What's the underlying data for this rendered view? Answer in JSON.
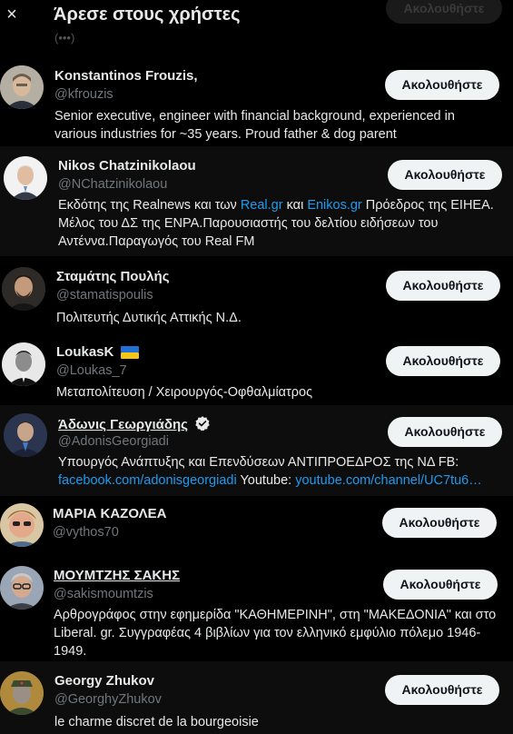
{
  "header": {
    "title": "Άρεσε στους χρήστες",
    "close_icon": "×",
    "partial_text": "(•••)"
  },
  "follow_label": "Ακολουθήστε",
  "users": [
    {
      "name": "Konstantinos Frouzis,",
      "handle": "@kfrouzis",
      "bio": "Senior executive, engineer with financial background, experienced in various industries for ~35 years. Proud father & dog parent"
    },
    {
      "name": "Nikos Chatzinikolaou",
      "handle": "@NChatzinikolaou",
      "bio_parts": [
        "Εκδότης της Realnews και των ",
        "Real.gr",
        " και ",
        "Enikos.gr",
        " Πρόεδρος της ΕΙΗΕΑ. Μέλος του ΔΣ της ΕΝΡΑ.Παρουσιαστής του δελτίου ειδήσεων του Αντέννα.Παραγωγός του Real FM"
      ]
    },
    {
      "name": "Σταμάτης Πουλής",
      "handle": "@stamatispoulis",
      "bio": "Πολιτευτής Δυτικής Αττικής Ν.Δ."
    },
    {
      "name": "LoukasK",
      "handle": "@Loukas_7",
      "flag": "ukraine-flag-emoji",
      "bio": "Μεταπολίτευση / Χειρουργός-Οφθαλμίατρος"
    },
    {
      "name": "Άδωνις Γεωργιάδης",
      "handle": "@AdonisGeorgiadi",
      "verified": true,
      "bio_parts": [
        "Υπουργός Ανάπτυξης και Επενδύσεων ΑΝΤΙΠΡΟΕΔΡΟΣ της ΝΔ FB: ",
        "facebook.com/adonisgeorgiadi",
        " Youtube: ",
        "youtube.com/channel/UC7tu6…"
      ]
    },
    {
      "name": "ΜΑΡΙΑ ΚΑΖΟΛΕΑ",
      "handle": "@vythos70",
      "bio": ""
    },
    {
      "name": "ΜΟΥΜΤΖΗΣ ΣΑΚΗΣ",
      "handle": "@sakismoumtzis",
      "bio": "Αρθρογράφος στην εφημερίδα \"ΚΑΘΗΜΕΡΙΝΗ\", στη \"ΜΑΚΕΔΟΝΙΑ\" και στο Liberal. gr. Συγγραφέας 4 βιβλίων για τον ελληνικό εμφύλιο πόλεμο 1946-1949."
    },
    {
      "name": "Georgy Zhukov",
      "handle": "@GeorghyZhukov",
      "bio": "le charme discret de la bourgeoisie"
    }
  ],
  "colors": {
    "background": "#000000",
    "text": "#e7e9ea",
    "muted": "#71767b",
    "link": "#1d9bf0",
    "button_bg": "#eff3f4",
    "verified_badge": "#e7e9ea"
  }
}
